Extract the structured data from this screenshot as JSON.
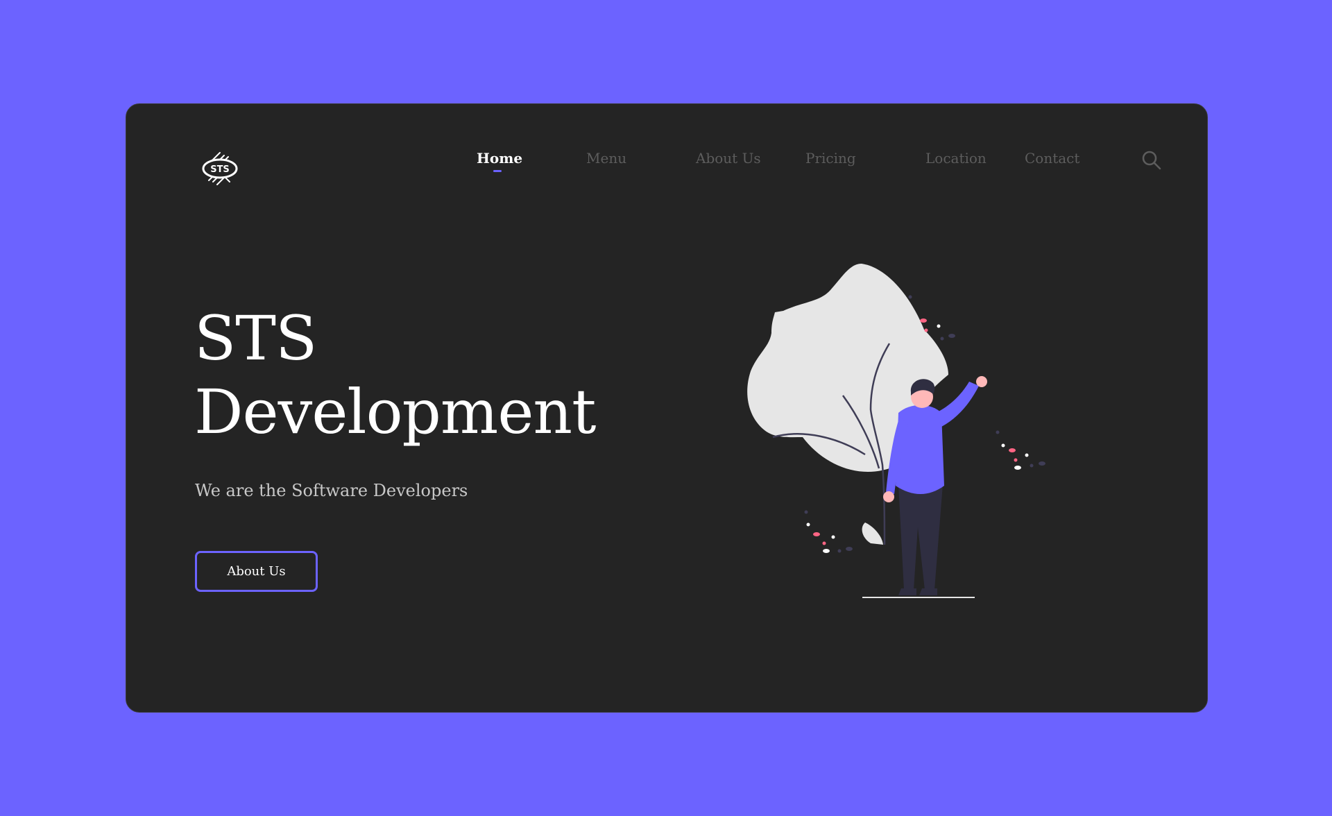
{
  "brand": {
    "logo_text": "STS"
  },
  "nav": {
    "items": [
      {
        "label": "Home",
        "active": true
      },
      {
        "label": "Menu",
        "active": false
      },
      {
        "label": "About Us",
        "active": false
      },
      {
        "label": "Pricing",
        "active": false
      },
      {
        "label": "Location",
        "active": false
      },
      {
        "label": "Contact",
        "active": false
      }
    ],
    "search_icon": "search-icon"
  },
  "hero": {
    "title_line1": "STS",
    "title_line2": "Development",
    "subtitle": "We are the Software Developers",
    "cta_label": "About Us"
  },
  "illustration": {
    "name": "person-waving-with-plant"
  },
  "colors": {
    "background": "#6c63ff",
    "card": "#242424",
    "accent": "#6c63ff",
    "text": "#ffffff",
    "nav_inactive": "#5d5d5d",
    "subtitle": "#c8c8c8"
  }
}
